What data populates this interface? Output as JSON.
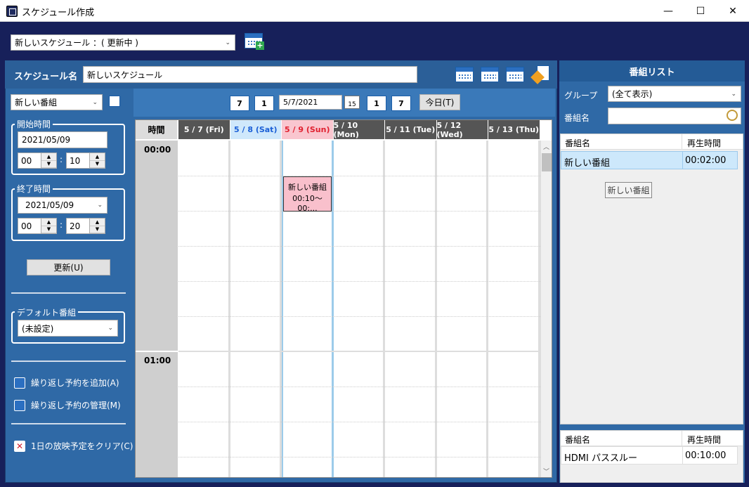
{
  "window": {
    "title": "スケジュール作成",
    "minimize": "—",
    "maximize": "☐",
    "close": "✕"
  },
  "top": {
    "schedule_select": "新しいスケジュール ：( 更新中 )",
    "arrow": "⌄"
  },
  "schedule": {
    "name_label": "スケジュール名",
    "name_value": "新しいスケジュール"
  },
  "left": {
    "program_select": "新しい番組",
    "start": {
      "label": "開始時間",
      "date": "2021/05/09",
      "hour": "00",
      "minute": "10",
      "colon": ":"
    },
    "end": {
      "label": "終了時間",
      "date": "2021/05/09",
      "hour": "00",
      "minute": "20",
      "colon": ":"
    },
    "update_button": "更新(U)",
    "default": {
      "label": "デフォルト番組",
      "value": "(未設定)"
    },
    "add_repeat": "繰り返し予約を追加(A)",
    "manage_repeat": "繰り返し予約の管理(M)",
    "clear_day": "1日の放映予定をクリア(C)"
  },
  "nav": {
    "week_back": "7",
    "day_back": "1",
    "date": "5/7/2021",
    "cal_badge": "15",
    "day_fwd": "1",
    "week_fwd": "7",
    "today": "今日(T)"
  },
  "grid": {
    "time_header": "時間",
    "days": [
      {
        "label": "5 / 7 (Fri)",
        "bg": "#555555",
        "fg": "#ffffff"
      },
      {
        "label": "5 / 8 (Sat)",
        "bg": "#cfe8fb",
        "fg": "#1a5fd6"
      },
      {
        "label": "5 / 9 (Sun)",
        "bg": "#f9c6cf",
        "fg": "#e0202f"
      },
      {
        "label": "5 / 10 (Mon)",
        "bg": "#555555",
        "fg": "#ffffff"
      },
      {
        "label": "5 / 11 (Tue)",
        "bg": "#555555",
        "fg": "#ffffff"
      },
      {
        "label": "5 / 12 (Wed)",
        "bg": "#555555",
        "fg": "#ffffff"
      },
      {
        "label": "5 / 13 (Thu)",
        "bg": "#555555",
        "fg": "#ffffff"
      }
    ],
    "hours": [
      "00:00",
      "01:00"
    ],
    "event": {
      "title": "新しい番組",
      "time": "00:10〜00:..."
    }
  },
  "program_list": {
    "title": "番組リスト",
    "group_label": "グループ",
    "group_value": "(全て表示)",
    "name_label": "番組名",
    "col_name": "番組名",
    "col_duration": "再生時間",
    "rows": [
      {
        "name": "新しい番組",
        "duration": "00:02:00"
      }
    ],
    "tooltip": "新しい番組",
    "bottom_rows": [
      {
        "name": "HDMI パススルー",
        "duration": "00:10:00"
      }
    ]
  },
  "colors": {
    "accent": "#2f69a6",
    "background": "#17205a"
  }
}
